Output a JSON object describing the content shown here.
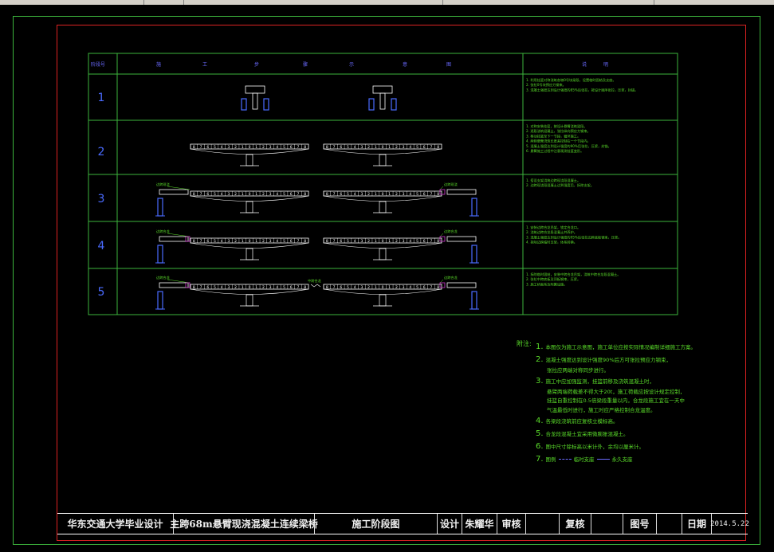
{
  "drawing": {
    "table": {
      "header_col1": "阶段号",
      "header_center": [
        "施",
        "工",
        "步",
        "骤",
        "示",
        "意",
        "图"
      ],
      "header_right": [
        "说",
        "明"
      ],
      "rows": [
        {
          "label": "1",
          "left_tag": "",
          "right_tag": "",
          "note_lines": [
            "1. 利用挂篮对称浇筑各墩0号块梁段，设置临时固结及支座。",
            "2. 张拉0号块预应力钢束。",
            "3. 混凝土强度达到设计强度的85%后张拉，按设计顺序张拉，压浆，封锚。"
          ]
        },
        {
          "label": "2",
          "left_tag": "",
          "right_tag": "",
          "note_lines": [
            "1. 对称安装挂篮，按设计悬臂浇筑梁段。",
            "2. 逐段浇筑混凝土，张拉纵向预应力钢束。",
            "3. 移动挂篮至下一节段，循环施工。",
            "4. 两侧悬臂浇筑长度差控制在一个节段内。",
            "5. 混凝土强度达到设计强度的90%后张拉，压浆，封锚。",
            "6. 悬臂施工过程中注意观测挂篮变形。"
          ]
        },
        {
          "label": "3",
          "left_tag": "边跨现浇",
          "right_tag": "边跨现浇",
          "note_lines": [
            "1. 搭设支架浇筑边跨现浇段混凝土。",
            "2. 边跨现浇段混凝土达到强度后，拆除支架。"
          ]
        },
        {
          "label": "4",
          "left_tag": "边跨合龙",
          "right_tag": "边跨合龙",
          "note_lines": [
            "1. 安装边跨合龙吊架，锁定合龙口。",
            "2. 浇筑边跨合龙段混凝土并养护。",
            "3. 混凝土强度达到设计强度的95%后张拉边跨底板钢束，压浆。",
            "4. 拆除边跨临时支架，体系转换。"
          ]
        },
        {
          "label": "5",
          "left_tag": "边跨合龙",
          "right_tag": "边跨合龙",
          "mid_tag": "中跨合龙",
          "note_lines": [
            "1. 拆除临时固结，安装中跨合龙吊架，浇筑中跨合龙段混凝土。",
            "2. 张拉中跨底板及顶板钢束，压浆。",
            "3. 施工桥面系及附属设施。"
          ]
        }
      ]
    },
    "notes": {
      "heading": "附注:",
      "items": [
        {
          "n": "1.",
          "lines": [
            "本图仅为施工示意图，施工单位应按实际情况编制详细施工方案。"
          ]
        },
        {
          "n": "2.",
          "lines": [
            "混凝土强度达到设计强度90%后方可张拉预应力钢束，",
            "张拉应两端对称同步进行。"
          ]
        },
        {
          "n": "3.",
          "lines": [
            "施工中应加强监测，挂篮前移及浇筑混凝土时，",
            "悬臂两端荷载差不得大于20t，施工荷载应按设计规定控制，",
            "挂篮自重控制在0.5倍梁段重量以内，合龙段施工宜在一天中",
            "气温最低时进行，施工时应严格控制合龙温度。"
          ]
        },
        {
          "n": "4.",
          "lines": [
            "各梁段浇筑前应复核立模标高。"
          ]
        },
        {
          "n": "5.",
          "lines": [
            "合龙段混凝土宜采用微膨胀混凝土。"
          ]
        },
        {
          "n": "6.",
          "lines": [
            "图中尺寸除标高以米计外，余均以厘米计。"
          ]
        },
        {
          "n": "7.",
          "lines_legend": true,
          "legend_a": "临时支座",
          "legend_b": "永久支座",
          "prefix": "图例"
        }
      ]
    },
    "segment_numbers": [
      "8",
      "7",
      "6",
      "5",
      "4",
      "3",
      "2",
      "1",
      "0",
      "1",
      "2",
      "3",
      "4",
      "5",
      "6",
      "7",
      "8"
    ],
    "colors": {
      "bg": "#000000",
      "table_line": "#3cb43c",
      "frame_red": "#dd2222",
      "beam": "#ffffff",
      "pier": "#4a6bff",
      "note_text": "#5adc2a",
      "tag_text": "#5adc2a",
      "magenta": "#d23cd2"
    }
  },
  "titleblock": {
    "school": "华东交通大学毕业设计",
    "project": "主跨68m悬臂现浇混凝土连续梁桥",
    "drawing_name": "施工阶段图",
    "design_label": "设计",
    "designer": "朱耀华",
    "review_label": "审核",
    "reviewer": "",
    "check_label": "复核",
    "checker": "",
    "drawing_no_label": "图号",
    "drawing_no": "",
    "date_label": "日期",
    "date": "2014.5.22"
  }
}
